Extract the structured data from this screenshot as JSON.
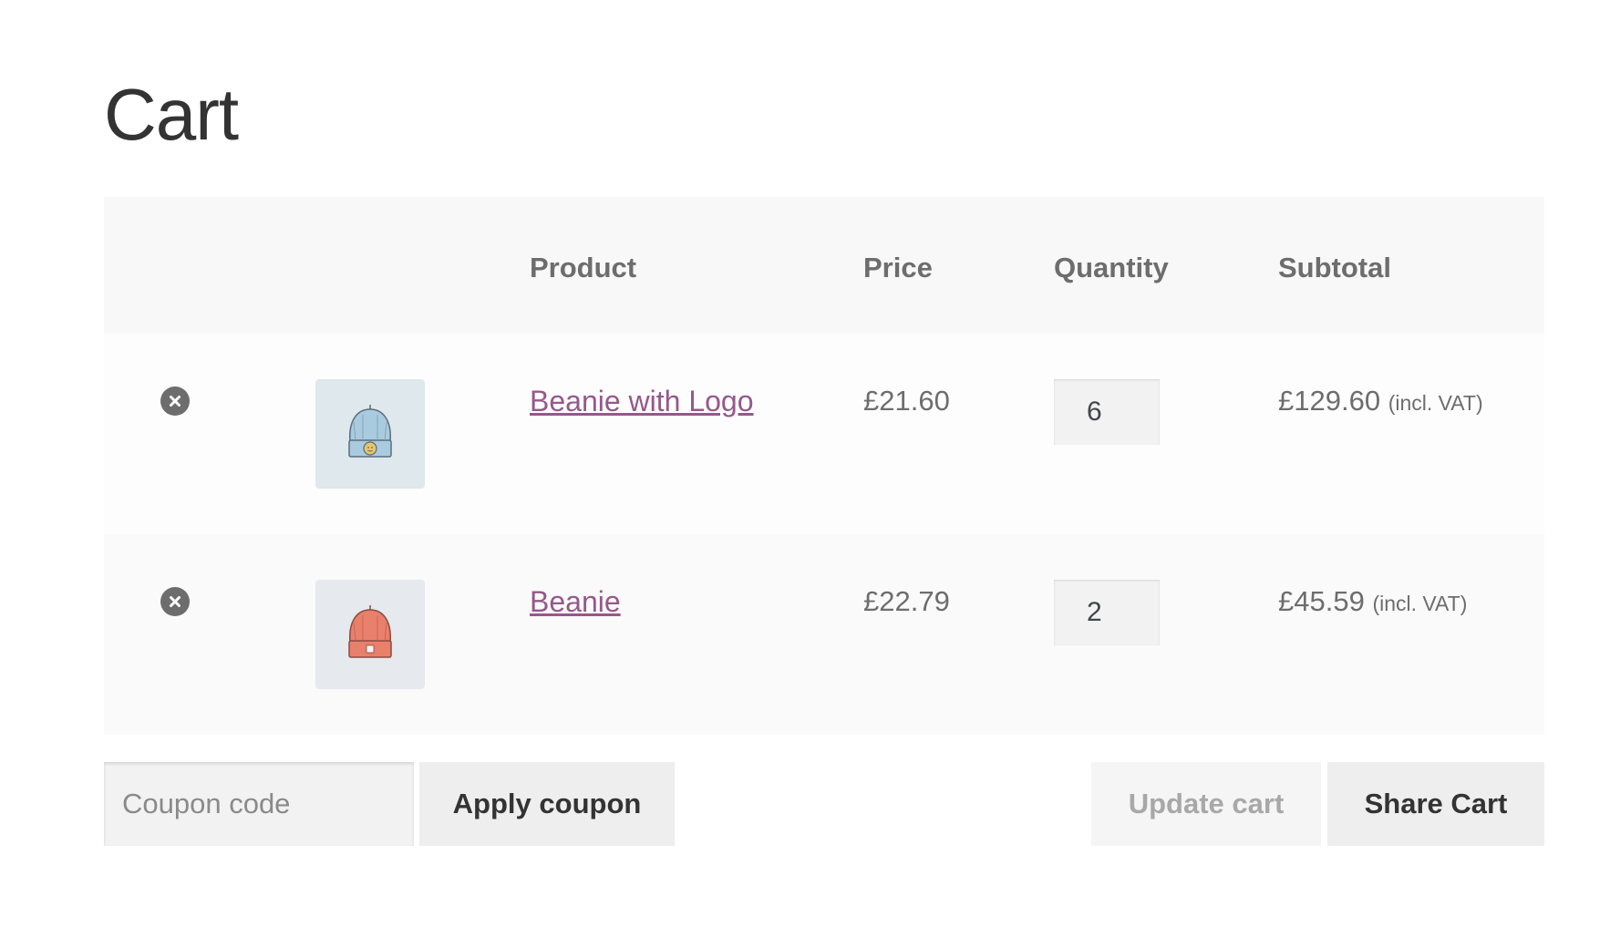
{
  "page": {
    "title": "Cart"
  },
  "table": {
    "headers": {
      "product": "Product",
      "price": "Price",
      "quantity": "Quantity",
      "subtotal": "Subtotal"
    },
    "rows": [
      {
        "name": "Beanie with Logo",
        "price": "£21.60",
        "quantity": "6",
        "subtotal": "£129.60",
        "tax_note": "(incl. VAT)",
        "image_color": "#a9cbe0",
        "image_icon": "beanie-with-logo-icon"
      },
      {
        "name": "Beanie",
        "price": "£22.79",
        "quantity": "2",
        "subtotal": "£45.59",
        "tax_note": "(incl. VAT)",
        "image_color": "#e8806c",
        "image_icon": "beanie-icon"
      }
    ]
  },
  "actions": {
    "coupon_placeholder": "Coupon code",
    "apply_coupon": "Apply coupon",
    "update_cart": "Update cart",
    "share_cart": "Share Cart"
  },
  "colors": {
    "link": "#96588a",
    "remove_icon": "#6d6d6d",
    "header_bg": "#f8f8f8"
  }
}
